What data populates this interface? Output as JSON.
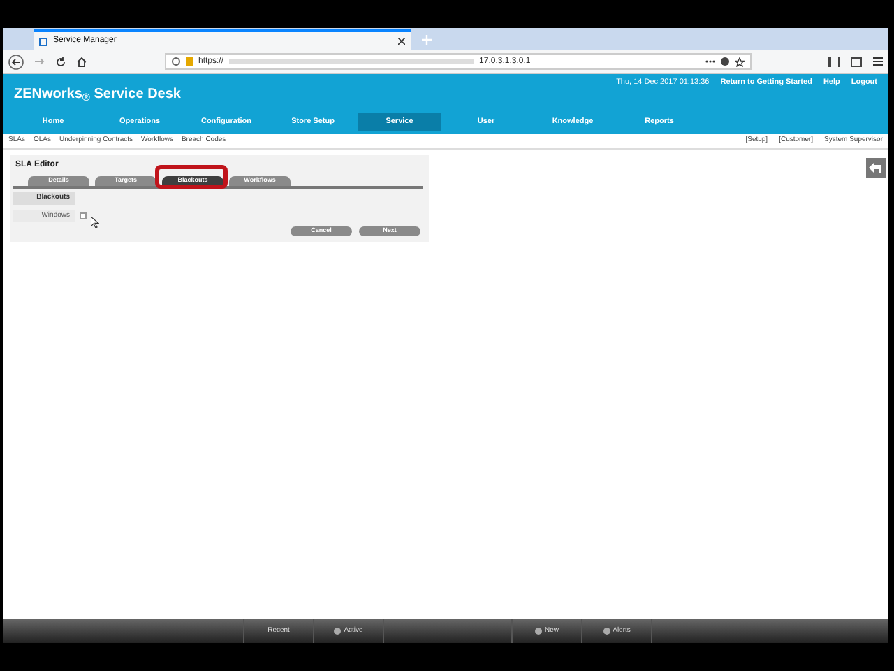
{
  "browser": {
    "tab_title": "Service Manager",
    "url_prefix": "https://",
    "url_suffix": "17.0.3.1.3.0.1"
  },
  "app": {
    "title": "ZENworks$_{®}$ Service Desk",
    "datetime": "Thu, 14 Dec 2017 01:13:36",
    "header_links": [
      "Return to Getting Started",
      "Help",
      "Logout"
    ],
    "nav": [
      {
        "label": "Home",
        "selected": false
      },
      {
        "label": "Operations",
        "selected": false
      },
      {
        "label": "Configuration",
        "selected": false
      },
      {
        "label": "Store Setup",
        "selected": false
      },
      {
        "label": "Service",
        "selected": true
      },
      {
        "label": "User",
        "selected": false
      },
      {
        "label": "Knowledge",
        "selected": false
      },
      {
        "label": "Reports",
        "selected": false
      }
    ],
    "subnav": [
      "SLAs",
      "OLAs",
      "Underpinning Contracts",
      "Workflows",
      "Breach Codes"
    ],
    "user_roles": [
      "[Setup]",
      "[Customer]",
      "System Supervisor"
    ]
  },
  "editor": {
    "title": "SLA Editor",
    "tabs": [
      {
        "label": "Details",
        "selected": false
      },
      {
        "label": "Targets",
        "selected": false
      },
      {
        "label": "Blackouts",
        "selected": true
      },
      {
        "label": "Workflows",
        "selected": false
      }
    ],
    "section": "Blackouts",
    "field_label": "Windows",
    "checked": false,
    "buttons": [
      "Cancel",
      "Next"
    ]
  },
  "bottom_bar": [
    {
      "label": "Recent",
      "kind": "plain"
    },
    {
      "label": "Active",
      "kind": "icon"
    },
    {
      "label": "New",
      "kind": "icon"
    },
    {
      "label": "Alerts",
      "kind": "icon"
    }
  ]
}
